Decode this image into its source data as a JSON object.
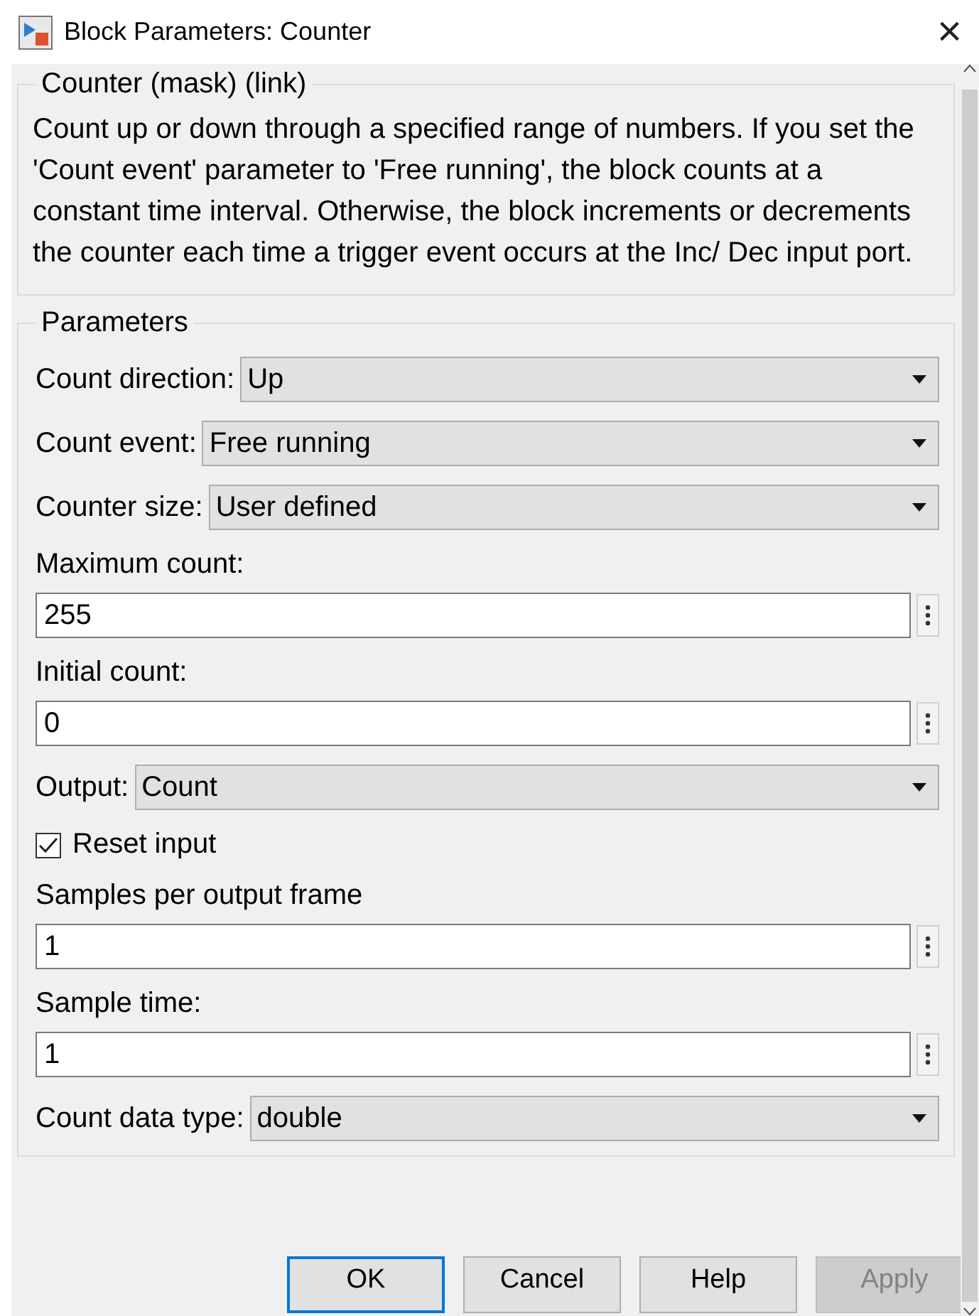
{
  "window": {
    "title": "Block Parameters: Counter",
    "close": "×"
  },
  "description": {
    "title": "Counter (mask) (link)",
    "text": "Count up or down through a specified range of numbers. If you set the 'Count event' parameter to 'Free running', the block counts at a constant time interval. Otherwise, the block increments or decrements the counter each time a trigger event occurs at the Inc/ Dec input port."
  },
  "parameters": {
    "title": "Parameters",
    "rows": [
      {
        "kind": "dropdown",
        "label": "Count direction:",
        "value": "Up"
      },
      {
        "kind": "dropdown",
        "label": "Count event:",
        "value": "Free running"
      },
      {
        "kind": "dropdown",
        "label": "Counter size:",
        "value": "User defined"
      },
      {
        "kind": "field",
        "label": "Maximum count:",
        "value": "255"
      },
      {
        "kind": "field",
        "label": "Initial count:",
        "value": "0"
      },
      {
        "kind": "dropdown",
        "label": "Output:",
        "value": "Count"
      },
      {
        "kind": "checkbox",
        "label": "Reset input",
        "checked": true
      },
      {
        "kind": "field",
        "label": "Samples per output frame",
        "value": "1"
      },
      {
        "kind": "field",
        "label": "Sample time:",
        "value": "1"
      },
      {
        "kind": "dropdown",
        "label": "Count data type:",
        "value": "double"
      }
    ]
  },
  "buttons": [
    {
      "label": "OK",
      "focused": true,
      "disabled": false
    },
    {
      "label": "Cancel",
      "focused": false,
      "disabled": false
    },
    {
      "label": "Help",
      "focused": false,
      "disabled": false
    },
    {
      "label": "Apply",
      "focused": false,
      "disabled": true
    }
  ]
}
